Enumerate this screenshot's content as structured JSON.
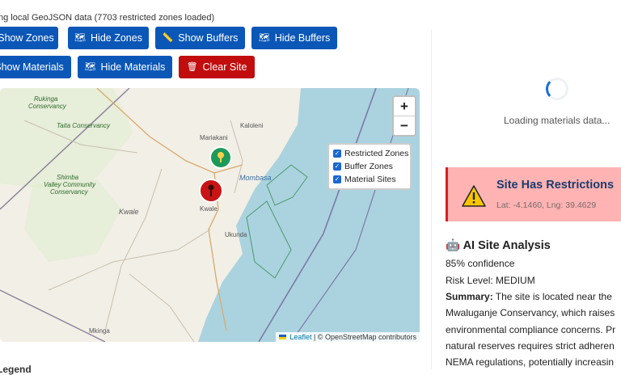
{
  "status_text": "ng local GeoJSON data (7703 restricted zones loaded)",
  "buttons": {
    "show_zones": "Show Zones",
    "hide_zones": "Hide Zones",
    "show_buffers": "Show Buffers",
    "hide_buffers": "Hide Buffers",
    "show_materials": "Show Materials",
    "hide_materials": "Hide Materials",
    "clear_site": "Clear Site"
  },
  "map": {
    "zoom_in": "+",
    "zoom_out": "−",
    "labels": {
      "rukinga": "Rukinga",
      "conservancy1": "Conservancy",
      "taita": "Taita Conservancy",
      "kaloleni": "Kaloleni",
      "mariakani": "Mariakani",
      "mombasa": "Mombasa",
      "shimba1": "Shimba",
      "shimba2": "Valley Community",
      "shimba3": "Conservancy",
      "kwale_region": "Kwale",
      "kwale_town": "Kwale",
      "ukunda": "Ukunda",
      "mkinga": "Mkinga"
    },
    "layers": {
      "restricted": "Restricted Zones",
      "buffer": "Buffer Zones",
      "material": "Material Sites"
    },
    "attribution_leaflet": "Leaflet",
    "attribution_rest": "| © OpenStreetMap contributors"
  },
  "legend_title": "Legend",
  "materials": {
    "loading_text": "Loading materials data..."
  },
  "site_alert": {
    "title": "Site Has Restrictions",
    "coords": "Lat: -4.1460, Lng: 39.4629"
  },
  "ai": {
    "title": "AI Site Analysis",
    "confidence": "85% confidence",
    "risk": "Risk Level: MEDIUM",
    "summary_label": "Summary:",
    "summary_lines": [
      " The site is located near the",
      "Mwaluganje Conservancy, which raises",
      "environmental compliance concerns. Pr",
      "natural reserves requires strict adheren",
      "NEMA regulations, potentially increasin"
    ]
  },
  "colors": {
    "button_blue": "#0b57b8",
    "button_red": "#c10d0d",
    "alert_bg": "#ffb3b3",
    "sea": "#aad3df"
  }
}
